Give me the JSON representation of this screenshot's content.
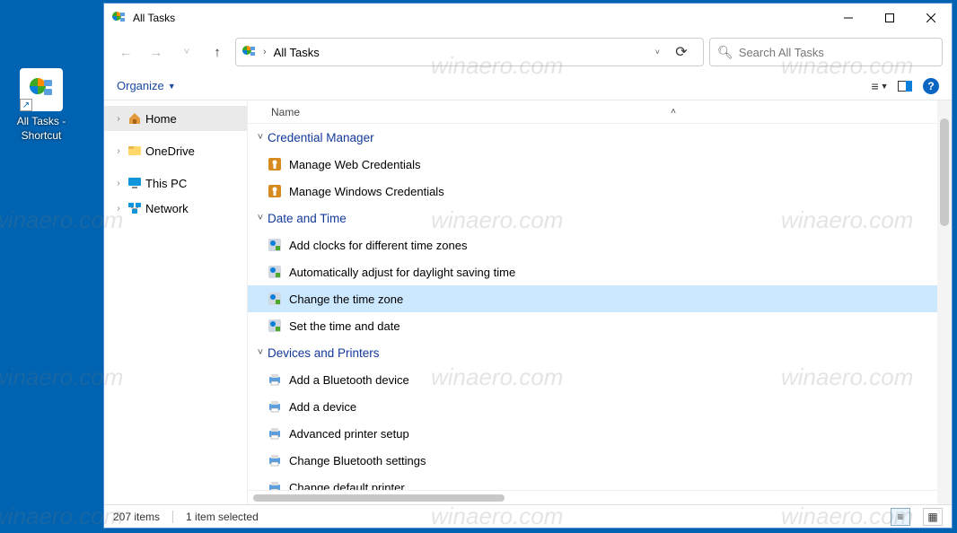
{
  "desktop": {
    "icon_label_line1": "All Tasks -",
    "icon_label_line2": "Shortcut"
  },
  "window": {
    "title": "All Tasks",
    "breadcrumb": "All Tasks",
    "search_placeholder": "Search All Tasks",
    "organize_label": "Organize",
    "column_name": "Name",
    "nav_items": [
      {
        "label": "Home",
        "icon": "home",
        "expandable": true,
        "selected": true
      },
      {
        "label": "OneDrive",
        "icon": "onedrive",
        "expandable": true,
        "selected": false
      },
      {
        "label": "This PC",
        "icon": "pc",
        "expandable": true,
        "selected": false
      },
      {
        "label": "Network",
        "icon": "network",
        "expandable": true,
        "selected": false
      }
    ],
    "groups": [
      {
        "name": "Credential Manager",
        "partial_top": true,
        "items": [
          "Manage Web Credentials",
          "Manage Windows Credentials"
        ]
      },
      {
        "name": "Date and Time",
        "items": [
          "Add clocks for different time zones",
          "Automatically adjust for daylight saving time",
          "Change the time zone",
          "Set the time and date"
        ]
      },
      {
        "name": "Devices and Printers",
        "items": [
          "Add a Bluetooth device",
          "Add a device",
          "Advanced printer setup",
          "Change Bluetooth settings",
          "Change default printer"
        ]
      }
    ],
    "selected_item": "Change the time zone",
    "status_items": "207 items",
    "status_selected": "1 item selected"
  },
  "watermark": "winaero.com"
}
